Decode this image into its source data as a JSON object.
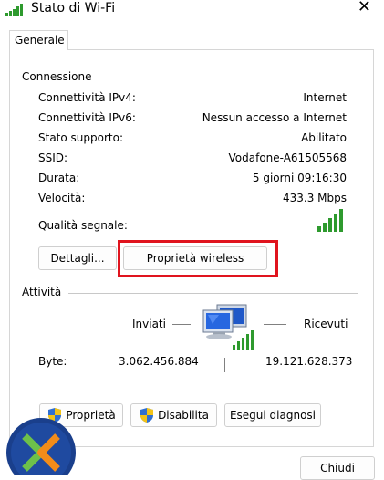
{
  "window": {
    "title": "Stato di Wi-Fi",
    "close_icon": "close-icon"
  },
  "tabs": [
    {
      "label": "Generale"
    }
  ],
  "connection": {
    "section_label": "Connessione",
    "rows": [
      {
        "label": "Connettività IPv4:",
        "value": "Internet"
      },
      {
        "label": "Connettività IPv6:",
        "value": "Nessun accesso a Internet"
      },
      {
        "label": "Stato supporto:",
        "value": "Abilitato"
      },
      {
        "label": "SSID:",
        "value": "Vodafone-A61505568"
      },
      {
        "label": "Durata:",
        "value": "5 giorni 09:16:30"
      },
      {
        "label": "Velocità:",
        "value": "433.3 Mbps"
      }
    ],
    "signal_label": "Qualità segnale:",
    "signal_bars": 5,
    "details_button": "Dettagli...",
    "wireless_props_button": "Proprietà wireless"
  },
  "activity": {
    "section_label": "Attività",
    "sent_label": "Inviati",
    "received_label": "Ricevuti",
    "bytes_label": "Byte:",
    "bytes_sent": "3.062.456.884",
    "bytes_received": "19.121.628.373"
  },
  "actions": {
    "properties_button": "Proprietà",
    "disable_button": "Disabilita",
    "diagnose_button": "Esegui diagnosi"
  },
  "footer": {
    "close_button": "Chiudi"
  },
  "colors": {
    "signal_green": "#2e9a2e",
    "highlight_red": "#e0141e",
    "shield_blue": "#2f6fd1",
    "shield_yellow": "#f2c318"
  }
}
